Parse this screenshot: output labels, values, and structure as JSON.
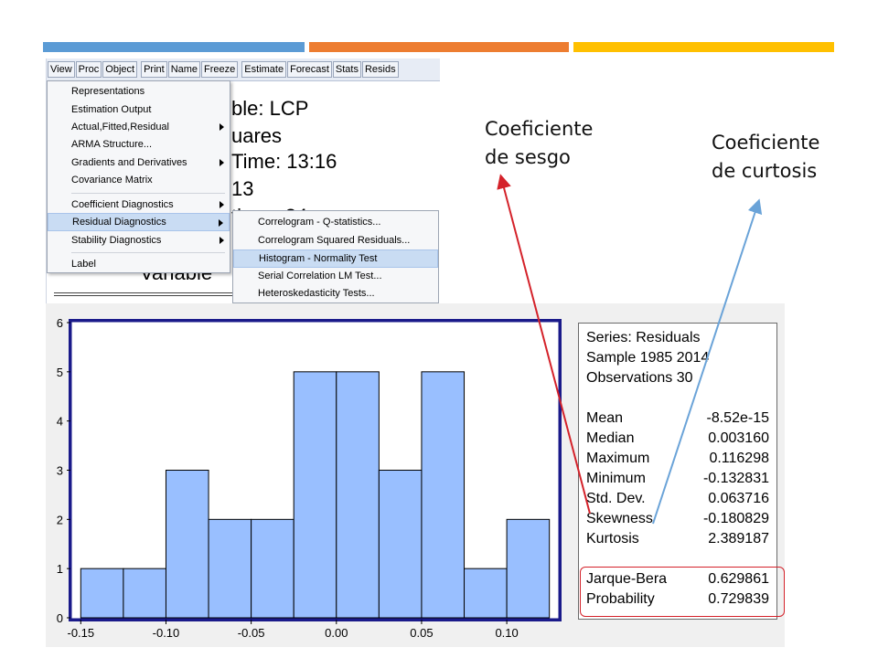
{
  "colors": {
    "bar_blue": "#5b9bd5",
    "bar_orange": "#ed7d31",
    "bar_gold": "#ffc000",
    "histogram_fill": "#99bfff",
    "plot_frame": "#1a1a8a",
    "arrow_red": "#d4222a",
    "arrow_blue": "#6aa3d8"
  },
  "toolbar": {
    "buttons": [
      "View",
      "Proc",
      "Object",
      "Print",
      "Name",
      "Freeze",
      "Estimate",
      "Forecast",
      "Stats",
      "Resids"
    ]
  },
  "background_text": {
    "line1": "ble: LCP",
    "line2": "uares",
    "line3": "Time: 13:16",
    "line4": "13",
    "line5": "tions: 34",
    "line6": "Variable"
  },
  "view_menu": {
    "items": [
      {
        "label": "Representations"
      },
      {
        "label": "Estimation Output"
      },
      {
        "label": "Actual,Fitted,Residual"
      },
      {
        "label": "ARMA Structure..."
      },
      {
        "label": "Gradients and Derivatives"
      },
      {
        "label": "Covariance Matrix"
      },
      {
        "label": "Coefficient Diagnostics"
      },
      {
        "label": "Residual Diagnostics"
      },
      {
        "label": "Stability Diagnostics"
      },
      {
        "label": "Label"
      }
    ]
  },
  "residual_submenu": {
    "items": [
      {
        "label": "Correlogram - Q-statistics..."
      },
      {
        "label": "Correlogram Squared Residuals..."
      },
      {
        "label": "Histogram - Normality Test"
      },
      {
        "label": "Serial Correlation LM Test..."
      },
      {
        "label": "Heteroskedasticity Tests..."
      }
    ]
  },
  "stats": {
    "series": "Series: Residuals",
    "sample": "Sample 1985 2014",
    "observations": "Observations 30",
    "rows": [
      {
        "label": "Mean",
        "value": "-8.52e-15"
      },
      {
        "label": "Median",
        "value": "0.003160"
      },
      {
        "label": "Maximum",
        "value": "0.116298"
      },
      {
        "label": "Minimum",
        "value": "-0.132831"
      },
      {
        "label": "Std. Dev.",
        "value": "0.063716"
      },
      {
        "label": "Skewness",
        "value": "-0.180829"
      },
      {
        "label": "Kurtosis",
        "value": "2.389187"
      }
    ],
    "jb_rows": [
      {
        "label": "Jarque-Bera",
        "value": "0.629861"
      },
      {
        "label": "Probability",
        "value": "0.729839"
      }
    ]
  },
  "annotations": {
    "skew_line1": "Coeficiente",
    "skew_line2": "de sesgo",
    "kurt_line1": "Coeficiente",
    "kurt_line2": "de curtosis"
  },
  "chart_data": {
    "type": "bar",
    "bin_width": 0.025,
    "bins": [
      {
        "x0": -0.15,
        "x1": -0.125,
        "count": 1
      },
      {
        "x0": -0.125,
        "x1": -0.1,
        "count": 1
      },
      {
        "x0": -0.1,
        "x1": -0.075,
        "count": 3
      },
      {
        "x0": -0.075,
        "x1": -0.05,
        "count": 2
      },
      {
        "x0": -0.05,
        "x1": -0.025,
        "count": 2
      },
      {
        "x0": -0.025,
        "x1": 0.0,
        "count": 5
      },
      {
        "x0": 0.0,
        "x1": 0.025,
        "count": 5
      },
      {
        "x0": 0.025,
        "x1": 0.05,
        "count": 3
      },
      {
        "x0": 0.05,
        "x1": 0.075,
        "count": 5
      },
      {
        "x0": 0.075,
        "x1": 0.1,
        "count": 1
      },
      {
        "x0": 0.1,
        "x1": 0.125,
        "count": 2
      }
    ],
    "xlim": [
      -0.155,
      0.13
    ],
    "ylim": [
      0,
      6
    ],
    "x_ticks": [
      "-0.15",
      "-0.10",
      "-0.05",
      "0.00",
      "0.05",
      "0.10"
    ],
    "x_tick_values": [
      -0.15,
      -0.1,
      -0.05,
      0.0,
      0.05,
      0.1
    ],
    "y_ticks": [
      "0",
      "1",
      "2",
      "3",
      "4",
      "5",
      "6"
    ],
    "y_tick_values": [
      0,
      1,
      2,
      3,
      4,
      5,
      6
    ],
    "grid": false,
    "legend": "none"
  }
}
